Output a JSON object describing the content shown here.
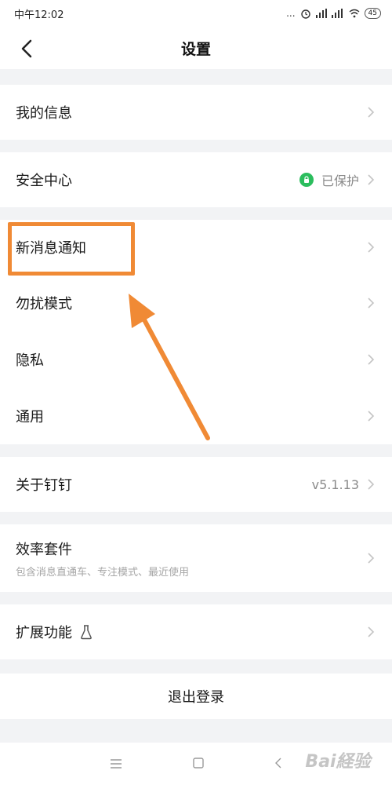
{
  "status_bar": {
    "time": "中午12:02",
    "dots": "...",
    "battery": "45"
  },
  "nav": {
    "title": "设置"
  },
  "rows": {
    "my_info": {
      "label": "我的信息"
    },
    "security": {
      "label": "安全中心",
      "status": "已保护"
    },
    "new_msg": {
      "label": "新消息通知"
    },
    "dnd": {
      "label": "勿扰模式"
    },
    "privacy": {
      "label": "隐私"
    },
    "general": {
      "label": "通用"
    },
    "about": {
      "label": "关于钉钉",
      "version": "v5.1.13"
    },
    "efficiency": {
      "label": "效率套件",
      "sub": "包含消息直通车、专注模式、最近使用"
    },
    "extensions": {
      "label": "扩展功能"
    }
  },
  "logout": {
    "label": "退出登录"
  },
  "colors": {
    "accent_orange": "#f08a35",
    "shield_green": "#2bbd5d"
  },
  "watermark": {
    "text": "Bai経验"
  }
}
